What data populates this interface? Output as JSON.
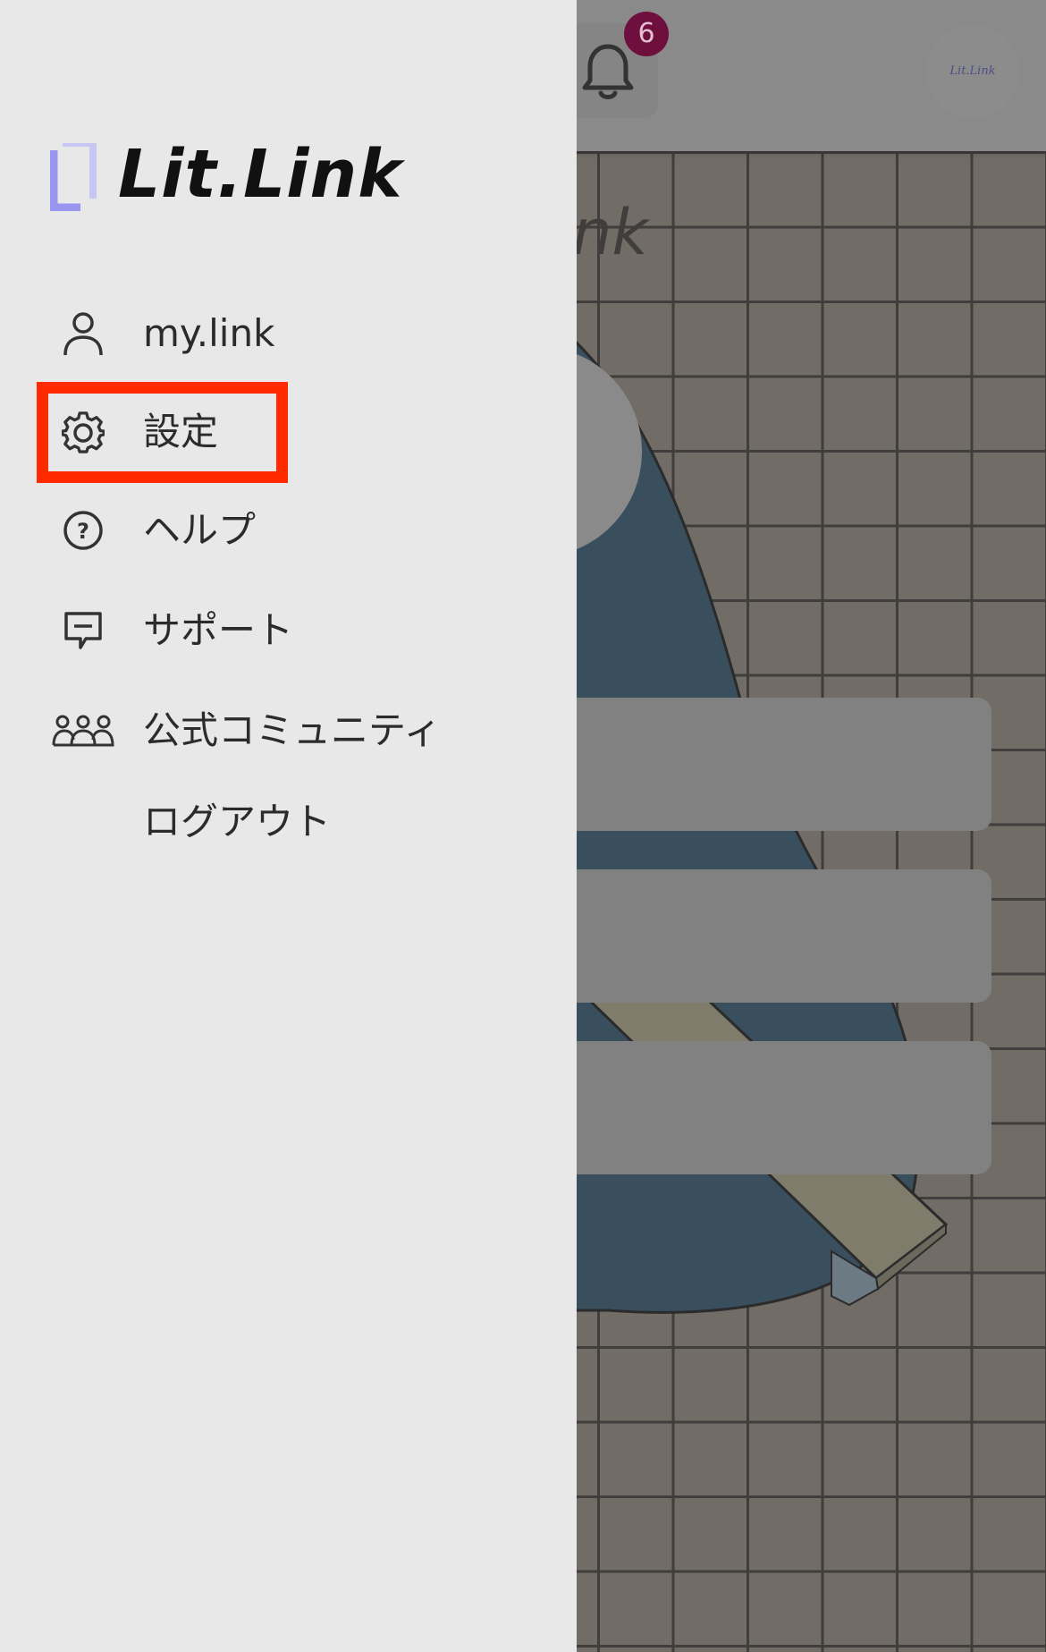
{
  "header": {
    "notification_count": "6",
    "avatar_text": "Lit.Link"
  },
  "drawer": {
    "logo_text": "Lit.Link",
    "menu": [
      {
        "label": "my.link",
        "icon": "user-icon"
      },
      {
        "label": "設定",
        "icon": "gear-icon"
      },
      {
        "label": "ヘルプ",
        "icon": "help-icon"
      },
      {
        "label": "サポート",
        "icon": "chat-icon"
      },
      {
        "label": "公式コミュニティ",
        "icon": "community-icon"
      },
      {
        "label": "ログアウト",
        "icon": ""
      }
    ]
  },
  "highlight": {
    "target": "settings",
    "color": "#ff2a00"
  },
  "colors": {
    "drawer_bg": "#e8e8e8",
    "overlay_bg": "#716c66",
    "badge": "#6e0f3d",
    "logo_accent": "#9a96f0"
  }
}
